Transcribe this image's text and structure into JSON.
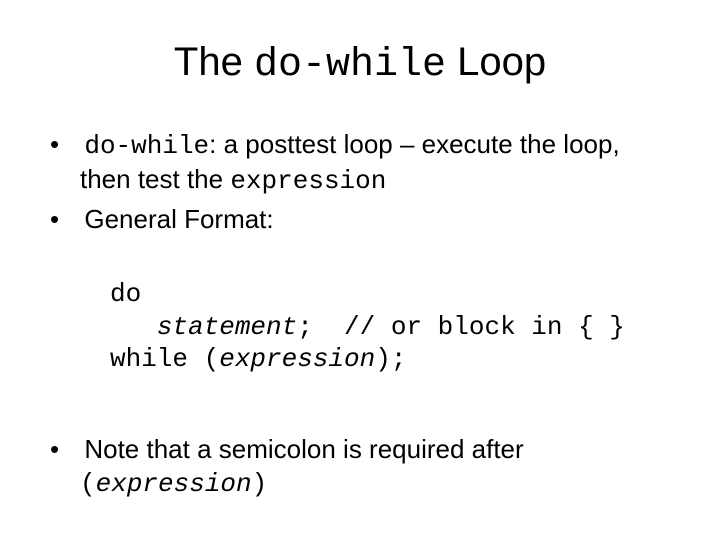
{
  "title": {
    "pre": "The ",
    "code": "do-while",
    "post": " Loop"
  },
  "bullet1": {
    "code1": "do-while",
    "t1": ": a posttest loop – execute the loop, then test the ",
    "code2": "expression"
  },
  "bullet2": {
    "t": "General Format:"
  },
  "code": {
    "l1": "do",
    "l2a": "   ",
    "l2b": "statement",
    "l2c": ";  // or block in { }",
    "l3a": "while (",
    "l3b": "expression",
    "l3c": ");"
  },
  "bullet3": {
    "t1": "Note that a semicolon is required after ",
    "code1a": "(",
    "code1b": "expression",
    "code1c": ")"
  }
}
